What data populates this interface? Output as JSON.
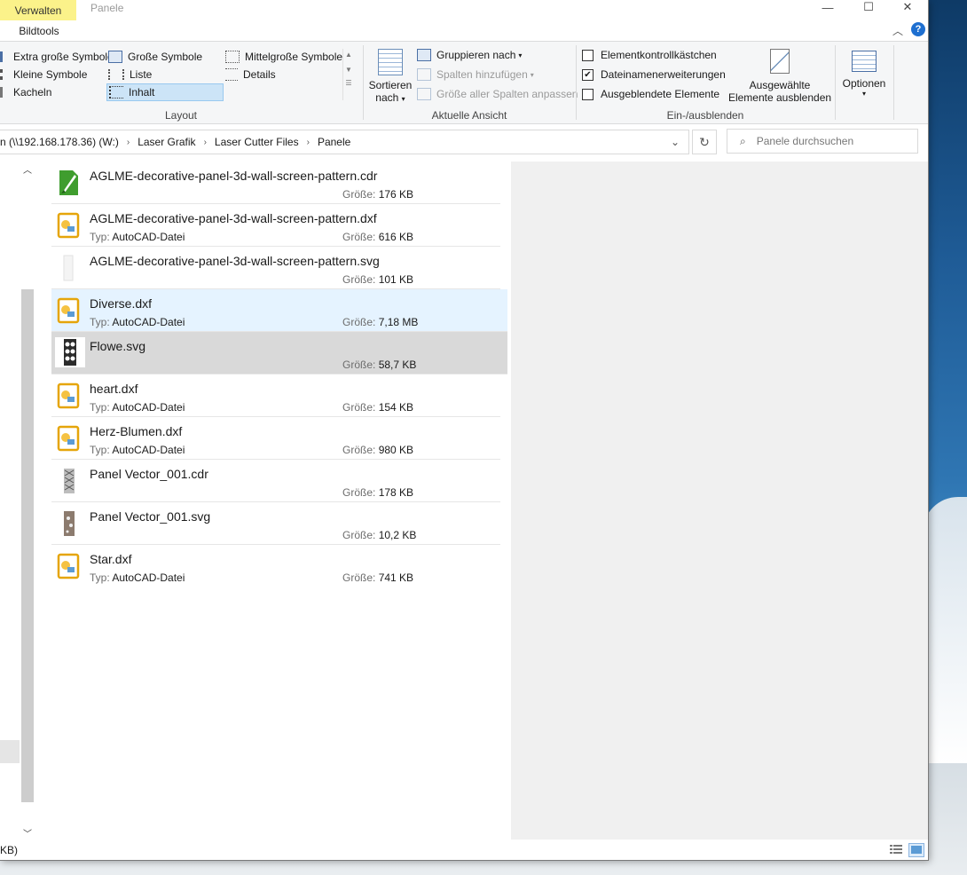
{
  "titlebar": {
    "context_tab": "Verwalten",
    "context_subtab": "Bildtools",
    "window_title": "Panele",
    "minimize": "—",
    "maximize": "☐",
    "close": "✕",
    "help": "?"
  },
  "ribbon": {
    "layout": {
      "label": "Layout",
      "items": [
        {
          "label": "Extra große Symbole"
        },
        {
          "label": "Große Symbole"
        },
        {
          "label": "Mittelgroße Symbole"
        },
        {
          "label": "Kleine Symbole"
        },
        {
          "label": "Liste"
        },
        {
          "label": "Details"
        },
        {
          "label": "Kacheln"
        },
        {
          "label": "Inhalt",
          "selected": true
        }
      ]
    },
    "current_view": {
      "label": "Aktuelle Ansicht",
      "sort_line1": "Sortieren",
      "sort_line2": "nach",
      "group_by": "Gruppieren nach",
      "add_columns": "Spalten hinzufügen",
      "size_all_columns": "Größe aller Spalten anpassen"
    },
    "show_hide": {
      "label": "Ein-/ausblenden",
      "checkboxes": [
        {
          "label": "Elementkontrollkästchen",
          "checked": false
        },
        {
          "label": "Dateinamenerweiterungen",
          "checked": true
        },
        {
          "label": "Ausgeblendete Elemente",
          "checked": false
        }
      ],
      "hide_selected_line1": "Ausgewählte",
      "hide_selected_line2": "Elemente ausblenden"
    },
    "options": {
      "label": "Optionen"
    }
  },
  "address": {
    "crumbs": [
      "n (\\\\192.168.178.36) (W:)",
      "Laser Grafik",
      "Laser Cutter Files",
      "Panele"
    ],
    "search_placeholder": "Panele durchsuchen"
  },
  "files": [
    {
      "name": "AGLME-decorative-panel-3d-wall-screen-pattern.cdr",
      "type": "",
      "size": "176 KB",
      "icon": "coreldraw-icon"
    },
    {
      "name": "AGLME-decorative-panel-3d-wall-screen-pattern.dxf",
      "type": "AutoCAD-Datei",
      "size": "616 KB",
      "icon": "dxf-icon"
    },
    {
      "name": "AGLME-decorative-panel-3d-wall-screen-pattern.svg",
      "type": "",
      "size": "101 KB",
      "icon": "svg-thumb-light"
    },
    {
      "name": "Diverse.dxf",
      "type": "AutoCAD-Datei",
      "size": "7,18 MB",
      "icon": "dxf-icon",
      "state": "hover"
    },
    {
      "name": "Flowe.svg",
      "type": "",
      "size": "58,7 KB",
      "icon": "svg-thumb-dark",
      "state": "selected"
    },
    {
      "name": "heart.dxf",
      "type": "AutoCAD-Datei",
      "size": "154 KB",
      "icon": "dxf-icon"
    },
    {
      "name": "Herz-Blumen.dxf",
      "type": "AutoCAD-Datei",
      "size": "980 KB",
      "icon": "dxf-icon"
    },
    {
      "name": "Panel Vector_001.cdr",
      "type": "",
      "size": "178 KB",
      "icon": "cdr-thumb"
    },
    {
      "name": "Panel Vector_001.svg",
      "type": "",
      "size": "10,2 KB",
      "icon": "svg-thumb-brown"
    },
    {
      "name": "Star.dxf",
      "type": "AutoCAD-Datei",
      "size": "741 KB",
      "icon": "dxf-icon"
    }
  ],
  "labels": {
    "type_key": "Typ:",
    "size_key": "Größe:"
  },
  "status": {
    "text": "KB)"
  }
}
